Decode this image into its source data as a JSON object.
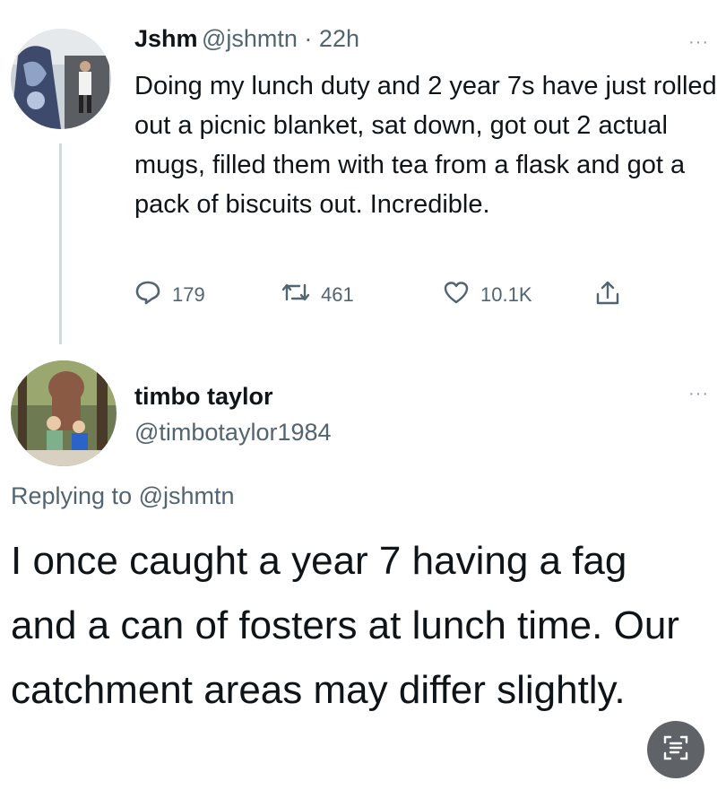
{
  "tweet": {
    "author_name": "Jshm",
    "author_meta": "@jshmtn · 22h",
    "text": "Doing my lunch duty and 2 year 7s have just rolled out a picnic blanket, sat down, got out 2 actual mugs, filled them with tea from a flask and got a pack of biscuits out. Incredible.",
    "replies": "179",
    "retweets": "461",
    "likes": "10.1K",
    "more_glyph": "···"
  },
  "reply": {
    "author_name": "timbo taylor",
    "author_handle": "@timbotaylor1984",
    "replying_prefix": "Replying to ",
    "replying_handle": "@jshmtn",
    "text": "I once caught a year 7 having a fag and a can of fosters at lunch time. Our catchment areas may differ slightly.",
    "more_glyph": "···"
  },
  "icons": {
    "reply": "reply-icon",
    "retweet": "retweet-icon",
    "like": "heart-icon",
    "share": "share-icon",
    "reader": "reader-mode-icon"
  },
  "colors": {
    "text": "#0f1419",
    "secondary": "#536471",
    "thread_line": "#cfd9de",
    "fab": "#5f6267"
  }
}
